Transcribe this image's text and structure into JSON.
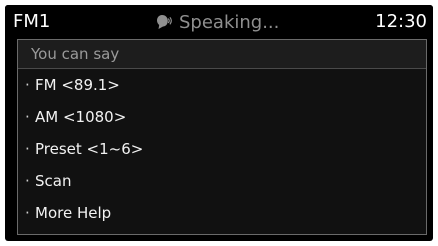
{
  "status_bar": {
    "mode": "FM1",
    "speaking_icon": "voice-speaking-icon",
    "speaking_text": "Speaking...",
    "time": "12:30"
  },
  "panel": {
    "title": "You can say",
    "bullet": "·",
    "commands": [
      {
        "label": "FM <89.1>"
      },
      {
        "label": "AM <1080>"
      },
      {
        "label": "Preset <1~6>"
      },
      {
        "label": "Scan"
      },
      {
        "label": "More Help"
      }
    ]
  },
  "colors": {
    "background": "#000000",
    "panel": "#111111",
    "panel_border": "#6a6a6a",
    "primary_text": "#ffffff",
    "muted_text": "#8f8f8f"
  }
}
